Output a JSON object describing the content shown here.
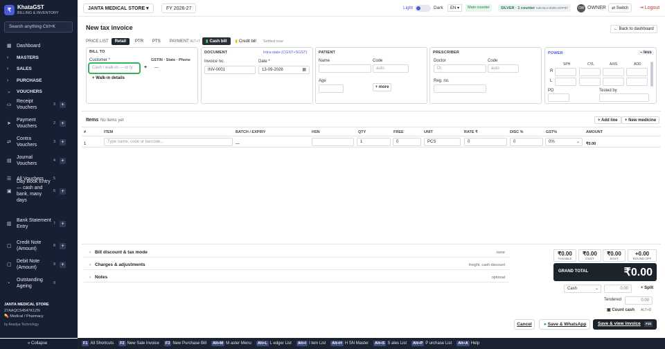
{
  "brand": {
    "name": "KhataGST",
    "tagline": "BILLING & INVENTORY",
    "logo_letter": "₹"
  },
  "sidebar": {
    "search": "Search anything  Ctrl+K",
    "items": [
      {
        "icon": "▦",
        "label": "Dashboard",
        "type": "link"
      },
      {
        "icon": "›",
        "label": "MASTERS",
        "type": "section"
      },
      {
        "icon": "›",
        "label": "SALES",
        "type": "section"
      },
      {
        "icon": "›",
        "label": "PURCHASE",
        "type": "section"
      },
      {
        "icon": "⌄",
        "label": "VOUCHERS",
        "type": "section"
      },
      {
        "icon": "▭",
        "label": "Receipt Vouchers",
        "count": "3",
        "add": "+"
      },
      {
        "icon": "➤",
        "label": "Payment Vouchers",
        "count": "2",
        "add": "+"
      },
      {
        "icon": "⇄",
        "label": "Contra Vouchers",
        "count": "3",
        "add": "+"
      },
      {
        "icon": "▤",
        "label": "Journal Vouchers",
        "count": "4",
        "add": "+"
      },
      {
        "icon": "☰",
        "label": "All Vouchers",
        "count": "5"
      },
      {
        "icon": "▣",
        "label": "Day Book Entry — cash and bank, many days",
        "count": "6",
        "add": "+"
      },
      {
        "icon": "▥",
        "label": "Bank Statement Entry",
        "count": "7",
        "add": "+"
      },
      {
        "icon": "▢",
        "label": "Credit Note (Amount)",
        "count": "8",
        "add": "+"
      },
      {
        "icon": "▢",
        "label": "Debit Note (Amount)",
        "count": "9",
        "add": "+"
      },
      {
        "icon": "◔",
        "label": "Outstanding Ageing",
        "count": "0"
      }
    ],
    "store_name": "JANTA MEDICAL STORE",
    "gstin": "27AAQCS4547K1ZN",
    "store_type": "Medical / Pharmacy",
    "powered": "by Anedya Technology",
    "collapse": "« Collapse"
  },
  "topbar": {
    "store": "JANTA MEDICAL STORE ▾",
    "fy": "FY 2026-27",
    "light": "Light",
    "dark": "Dark",
    "lang": "EN ▾",
    "counter": "Main counter",
    "license_tier": "SILVER · 1 counter",
    "license_code": "A40-SLV-2026-A07F97",
    "avatar": "OW",
    "role": "OWNER",
    "switch": "⇄ Switch",
    "logout": "⇥ Logout"
  },
  "page": {
    "title": "New tax invoice",
    "back": "← Back to dashboard",
    "price_list_label": "PRICE LIST",
    "price_tabs": [
      "Retail",
      "PTR",
      "PTS"
    ],
    "payment_label": "PAYMENT",
    "payment_shortcut": "ALT+T",
    "cash_bill": "Cash bill",
    "credit_bill": "Credit bill",
    "settled": "Settled now"
  },
  "bill_to": {
    "title": "BILL TO",
    "customer_label": "Customer *",
    "customer_placeholder": "Cash / walk-in — or ty",
    "add": "+",
    "gstin_label": "GSTIN · State · Phone",
    "gstin_value": "—",
    "walkin": "+ Walk-in details"
  },
  "document": {
    "title": "DOCUMENT",
    "supply": "Intra-state (CGST+SGST)",
    "invoice_label": "Invoice no.",
    "invoice_value": "INV-0001",
    "date_label": "Date *",
    "date_value": "13-09-2026"
  },
  "patient": {
    "title": "PATIENT",
    "name_label": "Name",
    "code_label": "Code",
    "code_placeholder": "auto",
    "age_label": "Age",
    "more": "+ more"
  },
  "prescriber": {
    "title": "PRESCRIBER",
    "doctor_label": "Doctor",
    "doctor_placeholder": "Dr.",
    "code_label": "Code",
    "code_placeholder": "auto",
    "reg_label": "Reg. no."
  },
  "power": {
    "title": "POWER",
    "less": "– less",
    "cols": [
      "SPH",
      "CYL",
      "AXIS",
      "ADD"
    ],
    "rows": [
      "R",
      "L"
    ],
    "pd": "PD",
    "tested": "Tested by"
  },
  "items": {
    "title": "Items",
    "note": "No items yet",
    "add_line": "+ Add line",
    "new_medicine": "+ New medicine",
    "headers": [
      "#",
      "ITEM",
      "BATCH / EXPIRY",
      "HSN",
      "QTY",
      "FREE",
      "UNIT",
      "RATE ₹",
      "DISC %",
      "GST%",
      "AMOUNT"
    ],
    "row": {
      "no": "1",
      "item_placeholder": "Type name, code or barcode...",
      "batch": "—",
      "qty": "1",
      "free": "0",
      "unit": "PCS",
      "rate": "0",
      "disc": "0",
      "gst": "0%",
      "amount": "₹0.00"
    }
  },
  "summary": {
    "sections": [
      {
        "label": "Bill discount & tax mode",
        "right": "none"
      },
      {
        "label": "Charges & adjustments",
        "right": "freight, cash discount"
      },
      {
        "label": "Notes",
        "right": "optional"
      }
    ],
    "totals": [
      {
        "value": "₹0.00",
        "label": "TAXABLE"
      },
      {
        "value": "₹0.00",
        "label": "CGST"
      },
      {
        "value": "₹0.00",
        "label": "SGST"
      },
      {
        "value": "+0.00",
        "label": "ROUND OFF"
      }
    ],
    "grand_label": "GRAND TOTAL",
    "grand_value": "₹0.00",
    "pay_mode": "Cash",
    "pay_amount": "0.00",
    "split": "+ Split",
    "tendered_label": "Tendered",
    "tendered_value": "0.00",
    "count_cash": "Count cash",
    "count_shortcut": "ALT+D"
  },
  "actions": {
    "cancel": "Cancel",
    "whatsapp": "Save & WhatsApp",
    "save_view": "Save & view invoice",
    "save_key": "F10"
  },
  "shortcuts": [
    {
      "key": "F1",
      "label": "All Shortcuts"
    },
    {
      "key": "F2",
      "label": "New Sale Invoice"
    },
    {
      "key": "F3",
      "label": "New Purchase Bill"
    },
    {
      "key": "Alt+M",
      "label": "M aster Menu"
    },
    {
      "key": "Alt+L",
      "label": "L edger List"
    },
    {
      "key": "Alt+I",
      "label": "I tem List"
    },
    {
      "key": "Alt+H",
      "label": "H SN Master"
    },
    {
      "key": "Alt+S",
      "label": "S ales List"
    },
    {
      "key": "Alt+P",
      "label": "P urchase List"
    },
    {
      "key": "Alt+A",
      "label": "Help"
    }
  ]
}
